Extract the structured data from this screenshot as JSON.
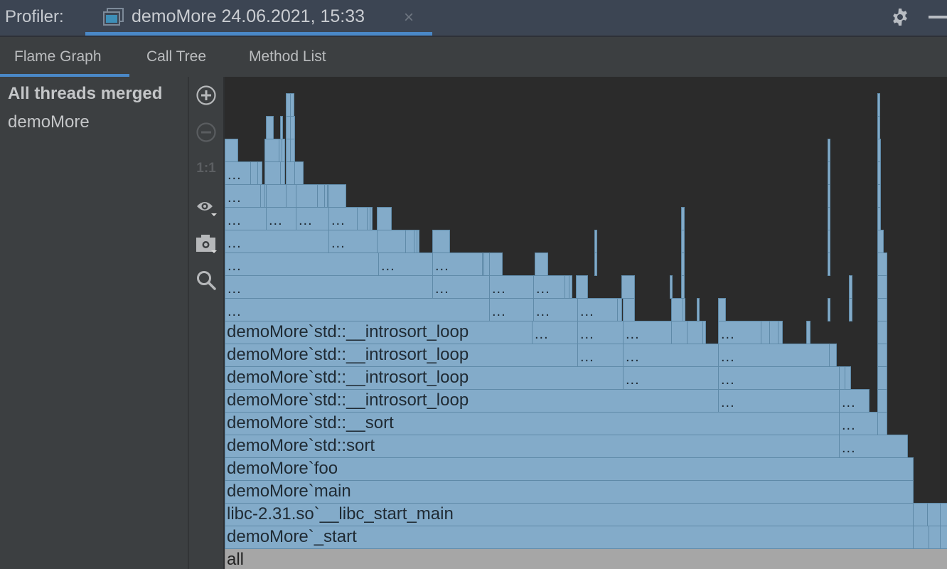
{
  "titlebar": {
    "app_label": "Profiler:",
    "tab_title": "demoMore 24.06.2021, 15:33",
    "close_glyph": "×",
    "settings_icon": "gear-icon",
    "minimize_icon": "minimize-icon"
  },
  "subtabs": [
    {
      "label": "Flame Graph",
      "active": true
    },
    {
      "label": "Call Tree",
      "active": false
    },
    {
      "label": "Method List",
      "active": false
    }
  ],
  "threads": {
    "merged": "All threads merged",
    "items": [
      "demoMore"
    ]
  },
  "toolbar": {
    "zoom_in": "zoom-in-icon",
    "zoom_out": "zoom-out-icon",
    "reset_label": "1:1",
    "view_options": "eye-icon",
    "capture": "camera-icon",
    "search": "search-icon"
  },
  "colors": {
    "frame": "#83abc9",
    "frame_border": "#5f8aa8",
    "root_frame": "#a6a6a6",
    "accent": "#4a88c7",
    "canvas": "#2b2b2b"
  },
  "flame": {
    "ellipsis": "...",
    "frames": [
      {
        "level": 0,
        "start": 0,
        "end": 1016,
        "label": "all",
        "root": true
      },
      {
        "level": 1,
        "start": 0,
        "end": 968,
        "label": "demoMore`_start"
      },
      {
        "level": 1,
        "start": 968,
        "end": 990,
        "label": ""
      },
      {
        "level": 1,
        "start": 990,
        "end": 1006,
        "label": ""
      },
      {
        "level": 1,
        "start": 1006,
        "end": 1016,
        "label": ""
      },
      {
        "level": 2,
        "start": 0,
        "end": 968,
        "label": "libc-2.31.so`__libc_start_main"
      },
      {
        "level": 2,
        "start": 968,
        "end": 988,
        "label": ""
      },
      {
        "level": 2,
        "start": 988,
        "end": 1006,
        "label": ""
      },
      {
        "level": 2,
        "start": 1006,
        "end": 1016,
        "label": ""
      },
      {
        "level": 3,
        "start": 0,
        "end": 968,
        "label": "demoMore`main"
      },
      {
        "level": 4,
        "start": 0,
        "end": 968,
        "label": "demoMore`foo"
      },
      {
        "level": 5,
        "start": 0,
        "end": 864,
        "label": "demoMore`std::sort"
      },
      {
        "level": 5,
        "start": 864,
        "end": 960,
        "label": "...",
        "dots": true
      },
      {
        "level": 6,
        "start": 0,
        "end": 864,
        "label": "demoMore`std::__sort"
      },
      {
        "level": 6,
        "start": 864,
        "end": 918,
        "label": "...",
        "dots": true
      },
      {
        "level": 6,
        "start": 918,
        "end": 931,
        "label": ""
      },
      {
        "level": 6,
        "start": 918,
        "end": 931,
        "label": ""
      },
      {
        "level": 7,
        "start": 0,
        "end": 694,
        "label": "demoMore`std::__introsort_loop"
      },
      {
        "level": 7,
        "start": 694,
        "end": 864,
        "label": "...",
        "dots": true
      },
      {
        "level": 7,
        "start": 864,
        "end": 906,
        "label": "...",
        "dots": true
      },
      {
        "level": 7,
        "start": 918,
        "end": 931,
        "label": ""
      },
      {
        "level": 8,
        "start": 0,
        "end": 560,
        "label": "demoMore`std::__introsort_loop"
      },
      {
        "level": 8,
        "start": 560,
        "end": 694,
        "label": "...",
        "dots": true
      },
      {
        "level": 8,
        "start": 694,
        "end": 864,
        "label": "...",
        "dots": true
      },
      {
        "level": 8,
        "start": 864,
        "end": 872,
        "label": ""
      },
      {
        "level": 8,
        "start": 872,
        "end": 880,
        "label": ""
      },
      {
        "level": 8,
        "start": 918,
        "end": 931,
        "label": ""
      },
      {
        "level": 9,
        "start": 0,
        "end": 496,
        "label": "demoMore`std::__introsort_loop"
      },
      {
        "level": 9,
        "start": 496,
        "end": 560,
        "label": "...",
        "dots": true
      },
      {
        "level": 9,
        "start": 560,
        "end": 694,
        "label": "...",
        "dots": true
      },
      {
        "level": 9,
        "start": 694,
        "end": 850,
        "label": "...",
        "dots": true
      },
      {
        "level": 9,
        "start": 850,
        "end": 860,
        "label": ""
      },
      {
        "level": 9,
        "start": 918,
        "end": 931,
        "label": ""
      },
      {
        "level": 10,
        "start": 0,
        "end": 432,
        "label": "demoMore`std::__introsort_loop"
      },
      {
        "level": 10,
        "start": 432,
        "end": 496,
        "label": "...",
        "dots": true
      },
      {
        "level": 10,
        "start": 496,
        "end": 560,
        "label": "...",
        "dots": true
      },
      {
        "level": 10,
        "start": 560,
        "end": 628,
        "label": "...",
        "dots": true
      },
      {
        "level": 10,
        "start": 628,
        "end": 650,
        "label": ""
      },
      {
        "level": 10,
        "start": 650,
        "end": 672,
        "label": ""
      },
      {
        "level": 10,
        "start": 672,
        "end": 676,
        "label": ""
      },
      {
        "level": 10,
        "start": 694,
        "end": 754,
        "label": "...",
        "dots": true
      },
      {
        "level": 10,
        "start": 754,
        "end": 766,
        "label": ""
      },
      {
        "level": 10,
        "start": 766,
        "end": 778,
        "label": ""
      },
      {
        "level": 10,
        "start": 778,
        "end": 784,
        "label": ""
      },
      {
        "level": 10,
        "start": 818,
        "end": 823,
        "label": ""
      },
      {
        "level": 10,
        "start": 918,
        "end": 931,
        "label": ""
      },
      {
        "level": 11,
        "start": 0,
        "end": 372,
        "label": "...",
        "dots": true
      },
      {
        "level": 11,
        "start": 372,
        "end": 434,
        "label": "...",
        "dots": true
      },
      {
        "level": 11,
        "start": 434,
        "end": 496,
        "label": "...",
        "dots": true
      },
      {
        "level": 11,
        "start": 496,
        "end": 552,
        "label": "...",
        "dots": true
      },
      {
        "level": 11,
        "start": 552,
        "end": 558,
        "label": ""
      },
      {
        "level": 11,
        "start": 560,
        "end": 576,
        "label": ""
      },
      {
        "level": 11,
        "start": 628,
        "end": 644,
        "label": ""
      },
      {
        "level": 11,
        "start": 644,
        "end": 646,
        "label": ""
      },
      {
        "level": 11,
        "start": 664,
        "end": 666,
        "label": ""
      },
      {
        "level": 11,
        "start": 694,
        "end": 704,
        "label": ""
      },
      {
        "level": 11,
        "start": 848,
        "end": 850,
        "label": ""
      },
      {
        "level": 11,
        "start": 878,
        "end": 882,
        "label": ""
      },
      {
        "level": 11,
        "start": 918,
        "end": 931,
        "label": ""
      },
      {
        "level": 12,
        "start": 0,
        "end": 292,
        "label": "...",
        "dots": true
      },
      {
        "level": 12,
        "start": 292,
        "end": 372,
        "label": "...",
        "dots": true
      },
      {
        "level": 12,
        "start": 372,
        "end": 434,
        "label": "...",
        "dots": true
      },
      {
        "level": 12,
        "start": 434,
        "end": 478,
        "label": "...",
        "dots": true
      },
      {
        "level": 12,
        "start": 478,
        "end": 484,
        "label": ""
      },
      {
        "level": 12,
        "start": 484,
        "end": 488,
        "label": ""
      },
      {
        "level": 12,
        "start": 494,
        "end": 510,
        "label": ""
      },
      {
        "level": 12,
        "start": 558,
        "end": 576,
        "label": ""
      },
      {
        "level": 12,
        "start": 626,
        "end": 628,
        "label": ""
      },
      {
        "level": 12,
        "start": 642,
        "end": 646,
        "label": ""
      },
      {
        "level": 12,
        "start": 878,
        "end": 882,
        "label": ""
      },
      {
        "level": 12,
        "start": 918,
        "end": 931,
        "label": ""
      },
      {
        "level": 13,
        "start": 0,
        "end": 216,
        "label": "...",
        "dots": true
      },
      {
        "level": 13,
        "start": 216,
        "end": 292,
        "label": "...",
        "dots": true
      },
      {
        "level": 13,
        "start": 292,
        "end": 362,
        "label": "...",
        "dots": true
      },
      {
        "level": 13,
        "start": 362,
        "end": 364,
        "label": ""
      },
      {
        "level": 13,
        "start": 364,
        "end": 372,
        "label": ""
      },
      {
        "level": 13,
        "start": 372,
        "end": 390,
        "label": ""
      },
      {
        "level": 13,
        "start": 436,
        "end": 454,
        "label": ""
      },
      {
        "level": 13,
        "start": 520,
        "end": 522,
        "label": ""
      },
      {
        "level": 13,
        "start": 642,
        "end": 646,
        "label": ""
      },
      {
        "level": 13,
        "start": 848,
        "end": 851,
        "label": ""
      },
      {
        "level": 13,
        "start": 918,
        "end": 931,
        "label": ""
      },
      {
        "level": 14,
        "start": 0,
        "end": 146,
        "label": "...",
        "dots": true
      },
      {
        "level": 14,
        "start": 146,
        "end": 214,
        "label": "...",
        "dots": true
      },
      {
        "level": 14,
        "start": 214,
        "end": 254,
        "label": ""
      },
      {
        "level": 14,
        "start": 254,
        "end": 266,
        "label": ""
      },
      {
        "level": 14,
        "start": 266,
        "end": 270,
        "label": ""
      },
      {
        "level": 14,
        "start": 270,
        "end": 272,
        "label": ""
      },
      {
        "level": 14,
        "start": 292,
        "end": 316,
        "label": ""
      },
      {
        "level": 14,
        "start": 520,
        "end": 522,
        "label": ""
      },
      {
        "level": 14,
        "start": 642,
        "end": 646,
        "label": ""
      },
      {
        "level": 14,
        "start": 848,
        "end": 851,
        "label": ""
      },
      {
        "level": 14,
        "start": 918,
        "end": 926,
        "label": ""
      },
      {
        "level": 15,
        "start": 0,
        "end": 58,
        "label": "...",
        "dots": true
      },
      {
        "level": 15,
        "start": 58,
        "end": 100,
        "label": "...",
        "dots": true
      },
      {
        "level": 15,
        "start": 100,
        "end": 146,
        "label": "...",
        "dots": true
      },
      {
        "level": 15,
        "start": 146,
        "end": 186,
        "label": "...",
        "dots": true
      },
      {
        "level": 15,
        "start": 186,
        "end": 200,
        "label": ""
      },
      {
        "level": 15,
        "start": 200,
        "end": 204,
        "label": ""
      },
      {
        "level": 15,
        "start": 204,
        "end": 206,
        "label": ""
      },
      {
        "level": 15,
        "start": 214,
        "end": 234,
        "label": ""
      },
      {
        "level": 15,
        "start": 642,
        "end": 646,
        "label": ""
      },
      {
        "level": 15,
        "start": 848,
        "end": 851,
        "label": ""
      },
      {
        "level": 15,
        "start": 918,
        "end": 922,
        "label": ""
      },
      {
        "level": 16,
        "start": 0,
        "end": 50,
        "label": "...",
        "dots": true
      },
      {
        "level": 16,
        "start": 50,
        "end": 56,
        "label": ""
      },
      {
        "level": 16,
        "start": 56,
        "end": 58,
        "label": ""
      },
      {
        "level": 16,
        "start": 58,
        "end": 86,
        "label": ""
      },
      {
        "level": 16,
        "start": 86,
        "end": 100,
        "label": ""
      },
      {
        "level": 16,
        "start": 100,
        "end": 130,
        "label": ""
      },
      {
        "level": 16,
        "start": 130,
        "end": 140,
        "label": ""
      },
      {
        "level": 16,
        "start": 140,
        "end": 144,
        "label": ""
      },
      {
        "level": 16,
        "start": 144,
        "end": 146,
        "label": ""
      },
      {
        "level": 16,
        "start": 146,
        "end": 170,
        "label": ""
      },
      {
        "level": 16,
        "start": 848,
        "end": 851,
        "label": ""
      },
      {
        "level": 16,
        "start": 918,
        "end": 922,
        "label": ""
      },
      {
        "level": 17,
        "start": 0,
        "end": 36,
        "label": "...",
        "dots": true
      },
      {
        "level": 17,
        "start": 36,
        "end": 46,
        "label": ""
      },
      {
        "level": 17,
        "start": 46,
        "end": 52,
        "label": ""
      },
      {
        "level": 17,
        "start": 56,
        "end": 78,
        "label": ""
      },
      {
        "level": 17,
        "start": 78,
        "end": 84,
        "label": ""
      },
      {
        "level": 17,
        "start": 86,
        "end": 98,
        "label": ""
      },
      {
        "level": 17,
        "start": 98,
        "end": 110,
        "label": ""
      },
      {
        "level": 17,
        "start": 848,
        "end": 851,
        "label": ""
      },
      {
        "level": 17,
        "start": 918,
        "end": 922,
        "label": ""
      },
      {
        "level": 18,
        "start": 0,
        "end": 18,
        "label": ""
      },
      {
        "level": 18,
        "start": 56,
        "end": 76,
        "label": ""
      },
      {
        "level": 18,
        "start": 76,
        "end": 80,
        "label": ""
      },
      {
        "level": 18,
        "start": 80,
        "end": 84,
        "label": ""
      },
      {
        "level": 18,
        "start": 86,
        "end": 92,
        "label": ""
      },
      {
        "level": 18,
        "start": 92,
        "end": 98,
        "label": ""
      },
      {
        "level": 18,
        "start": 848,
        "end": 851,
        "label": ""
      },
      {
        "level": 18,
        "start": 918,
        "end": 922,
        "label": ""
      },
      {
        "level": 19,
        "start": 58,
        "end": 68,
        "label": ""
      },
      {
        "level": 19,
        "start": 78,
        "end": 80,
        "label": ""
      },
      {
        "level": 19,
        "start": 86,
        "end": 92,
        "label": ""
      },
      {
        "level": 19,
        "start": 92,
        "end": 98,
        "label": ""
      },
      {
        "level": 19,
        "start": 918,
        "end": 920,
        "label": ""
      },
      {
        "level": 20,
        "start": 86,
        "end": 92,
        "label": ""
      },
      {
        "level": 20,
        "start": 92,
        "end": 97,
        "label": ""
      },
      {
        "level": 20,
        "start": 918,
        "end": 920,
        "label": ""
      }
    ]
  }
}
